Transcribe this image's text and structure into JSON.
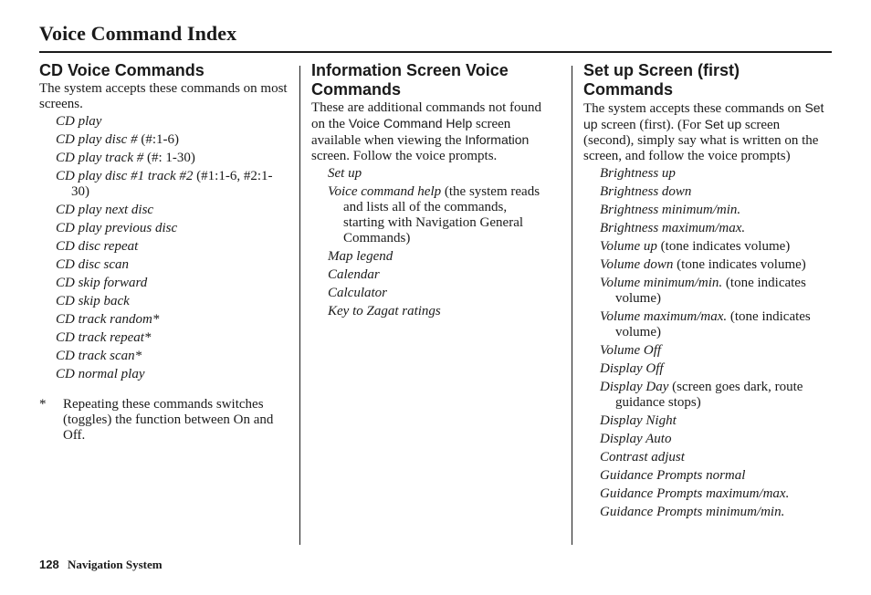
{
  "page": {
    "title": "Voice Command Index",
    "footer": {
      "page_number": "128",
      "section": "Navigation System"
    }
  },
  "columns": [
    {
      "heading": "CD Voice Commands",
      "intro": [
        {
          "text": "The system accepts these commands on most screens.",
          "style": "serif"
        }
      ],
      "commands": [
        {
          "command": "CD play",
          "note": ""
        },
        {
          "command": "CD play disc #",
          "note": " (#:1-6)"
        },
        {
          "command": "CD play track #",
          "note": " (#: 1-30)"
        },
        {
          "command": "CD play disc #1 track #2",
          "note": " (#1:1-6, #2:1-30)"
        },
        {
          "command": "CD play next disc",
          "note": ""
        },
        {
          "command": "CD play previous disc",
          "note": ""
        },
        {
          "command": "CD disc repeat",
          "note": ""
        },
        {
          "command": "CD disc scan",
          "note": ""
        },
        {
          "command": "CD skip forward",
          "note": ""
        },
        {
          "command": "CD skip back",
          "note": ""
        },
        {
          "command": "CD track random*",
          "note": ""
        },
        {
          "command": "CD track repeat*",
          "note": ""
        },
        {
          "command": "CD track scan*",
          "note": ""
        },
        {
          "command": "CD normal play",
          "note": ""
        }
      ],
      "footnote": {
        "marker": "*",
        "text": "Repeating these commands switches (toggles) the function between On and Off."
      }
    },
    {
      "heading": "Information Screen Voice Commands",
      "intro": [
        {
          "text": "These are additional commands not found on the ",
          "style": "serif"
        },
        {
          "text": "Voice Command Help",
          "style": "sans"
        },
        {
          "text": " screen available when viewing the ",
          "style": "serif"
        },
        {
          "text": "Information",
          "style": "sans"
        },
        {
          "text": " screen. Follow the voice prompts.",
          "style": "serif"
        }
      ],
      "commands": [
        {
          "command": "Set up",
          "note": ""
        },
        {
          "command": "Voice command help",
          "note": " (the system reads and lists all of the commands, starting with Navigation General Commands)"
        },
        {
          "command": "Map legend",
          "note": ""
        },
        {
          "command": "Calendar",
          "note": ""
        },
        {
          "command": "Calculator",
          "note": ""
        },
        {
          "command": "Key to Zagat ratings",
          "note": ""
        }
      ]
    },
    {
      "heading": "Set up Screen (first) Commands",
      "intro": [
        {
          "text": "The system accepts these commands on ",
          "style": "serif"
        },
        {
          "text": "Set up",
          "style": "sans"
        },
        {
          "text": " screen (first). (For ",
          "style": "serif"
        },
        {
          "text": "Set up",
          "style": "sans"
        },
        {
          "text": " screen (second), simply say what is written on the screen, and follow the voice prompts)",
          "style": "serif"
        }
      ],
      "commands": [
        {
          "command": "Brightness up",
          "note": ""
        },
        {
          "command": "Brightness down",
          "note": ""
        },
        {
          "command": "Brightness minimum/min.",
          "note": ""
        },
        {
          "command": "Brightness maximum/max.",
          "note": ""
        },
        {
          "command": "Volume up",
          "note": " (tone indicates volume)"
        },
        {
          "command": "Volume down",
          "note": " (tone indicates volume)"
        },
        {
          "command": "Volume minimum/min.",
          "note": " (tone indicates volume)"
        },
        {
          "command": "Volume maximum/max.",
          "note": " (tone indicates volume)"
        },
        {
          "command": "Volume Off",
          "note": ""
        },
        {
          "command": "Display Off",
          "note": ""
        },
        {
          "command": "Display Day",
          "note": " (screen goes dark, route guidance stops)"
        },
        {
          "command": "Display Night",
          "note": ""
        },
        {
          "command": "Display Auto",
          "note": ""
        },
        {
          "command": "Contrast adjust",
          "note": ""
        },
        {
          "command": "Guidance Prompts normal",
          "note": ""
        },
        {
          "command": "Guidance Prompts maximum/max.",
          "note": ""
        },
        {
          "command": "Guidance Prompts minimum/min.",
          "note": ""
        }
      ]
    }
  ]
}
